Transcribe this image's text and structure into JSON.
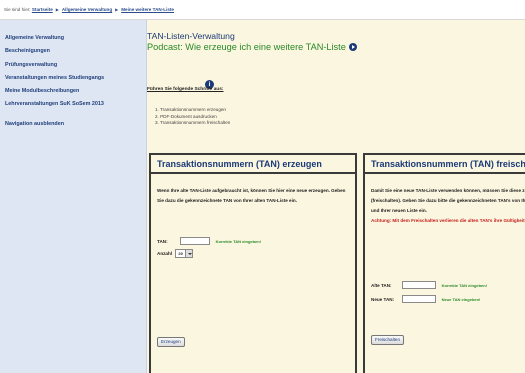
{
  "breadcrumb": {
    "label": "Sie sind hier:",
    "items": [
      "Startseite",
      "Allgemeine Verwaltung",
      "Meine weitere TAN-Liste"
    ]
  },
  "sidebar": {
    "items": [
      "Allgemeine Verwaltung",
      "Bescheinigungen",
      "Prüfungsverwaltung",
      "Veranstaltungen meines Studiengangs",
      "Meine Modulbeschreibungen",
      "Lehrveranstaltungen SuK SoSem 2013"
    ],
    "hide_nav": "Navigation ausblenden"
  },
  "main": {
    "title": "TAN-Listen-Verwaltung",
    "subtitle": "Podcast: Wie erzeuge ich eine weitere TAN-Liste",
    "steps_heading": "Führen Sie folgende Schritte aus:",
    "steps": [
      "1. Transaktionsnummern erzeugen",
      "2. PDF-Dokument ausdrucken",
      "3. Transaktionsnummern freischalten"
    ],
    "box1": {
      "title": "Transaktionsnummern (TAN) erzeugen",
      "text": "Wenn Ihre alte TAN-Liste aufgebraucht ist, können Sie hier eine neue erzeugen. Geben Sie dazu die gekennzeichnete TAN von Ihrer alten TAN-Liste ein.",
      "tan_label": "TAN:",
      "tan_hint": "Korrekte TAN eingeben!",
      "count_label": "Anzahl",
      "count_value": "20",
      "button": "Erzeugen"
    },
    "box2": {
      "title": "Transaktionsnummern (TAN) freischalten",
      "text": "Damit Sie eine neue TAN-Liste verwenden können, müssen Sie diese zuerst aktivieren (freischalten). Geben Sie dazu bitte die gekennzeichneten TAN's von Ihrer alten Liste und Ihrer neuen Liste ein.",
      "warning": "Achtung: Mit dem Freischalten verlieren die alten TAN's ihre Gültigkeit.",
      "old_tan_label": "Alte TAN:",
      "old_tan_hint": "Korrekte TAN eingeben!",
      "new_tan_label": "Neue TAN:",
      "new_tan_hint": "Neue TAN eingeben!",
      "button": "Freischalten"
    }
  }
}
